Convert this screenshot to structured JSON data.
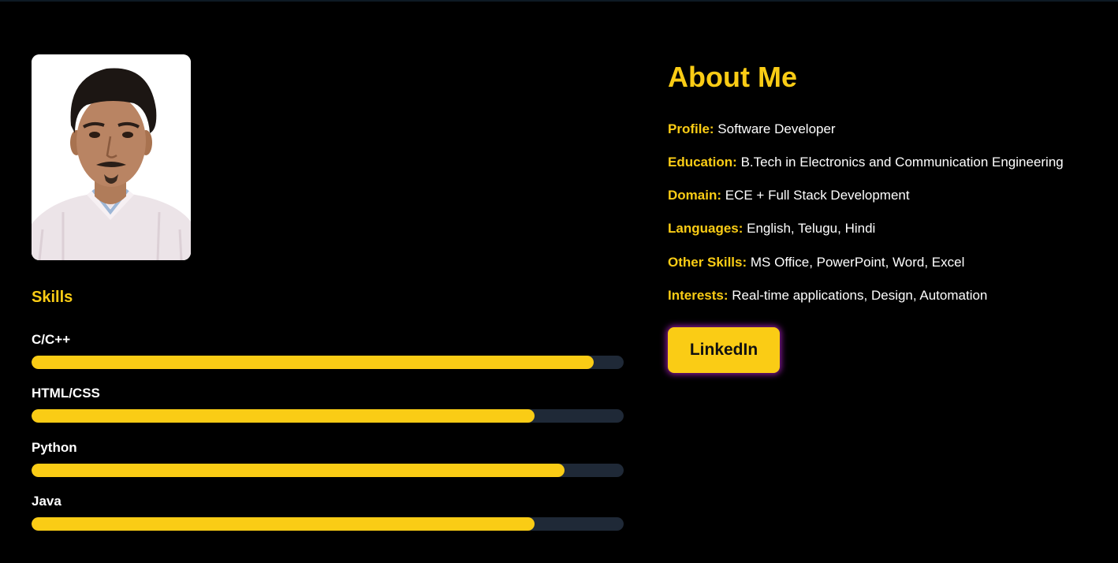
{
  "colors": {
    "accent": "#facc15",
    "track": "#1f2937",
    "text": "#ffffff",
    "background": "#000000",
    "button_glow": "#8a1a9b"
  },
  "profile_photo": {
    "icon": "person-portrait"
  },
  "skills": {
    "title": "Skills",
    "items": [
      {
        "name": "C/C++",
        "level": 0.95
      },
      {
        "name": "HTML/CSS",
        "level": 0.85
      },
      {
        "name": "Python",
        "level": 0.9
      },
      {
        "name": "Java",
        "level": 0.85
      }
    ]
  },
  "about": {
    "title": "About Me",
    "rows": [
      {
        "label": "Profile:",
        "value": "Software Developer"
      },
      {
        "label": "Education:",
        "value": "B.Tech in Electronics and Communication Engineering"
      },
      {
        "label": "Domain:",
        "value": "ECE + Full Stack Development"
      },
      {
        "label": "Languages:",
        "value": "English, Telugu, Hindi"
      },
      {
        "label": "Other Skills:",
        "value": "MS Office, PowerPoint, Word, Excel"
      },
      {
        "label": "Interests:",
        "value": "Real-time applications, Design, Automation"
      }
    ],
    "button_label": "LinkedIn"
  }
}
